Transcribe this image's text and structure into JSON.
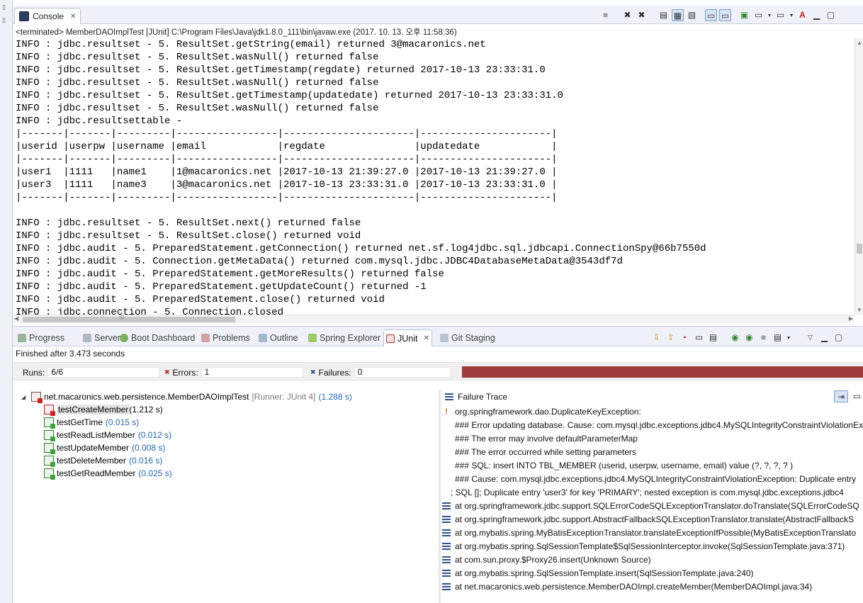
{
  "console": {
    "tab_label": "Console",
    "terminated_line": "<terminated> MemberDAOImplTest [JUnit] C:\\Program Files\\Java\\jdk1.8.0_111\\bin\\javaw.exe (2017. 10. 13. 오후 11:58:36)",
    "lines": [
      "INFO : jdbc.resultset - 5. ResultSet.getString(email) returned 3@macaronics.net",
      "INFO : jdbc.resultset - 5. ResultSet.wasNull() returned false",
      "INFO : jdbc.resultset - 5. ResultSet.getTimestamp(regdate) returned 2017-10-13 23:33:31.0",
      "INFO : jdbc.resultset - 5. ResultSet.wasNull() returned false",
      "INFO : jdbc.resultset - 5. ResultSet.getTimestamp(updatedate) returned 2017-10-13 23:33:31.0",
      "INFO : jdbc.resultset - 5. ResultSet.wasNull() returned false",
      "INFO : jdbc.resultsettable -",
      "|-------|-------|---------|-----------------|----------------------|----------------------|",
      "|userid |userpw |username |email            |regdate               |updatedate            |",
      "|-------|-------|---------|-----------------|----------------------|----------------------|",
      "|user1  |1111   |name1    |1@macaronics.net |2017-10-13 21:39:27.0 |2017-10-13 21:39:27.0 |",
      "|user3  |1111   |name3    |3@macaronics.net |2017-10-13 23:33:31.0 |2017-10-13 23:33:31.0 |",
      "|-------|-------|---------|-----------------|----------------------|----------------------|",
      "",
      "INFO : jdbc.resultset - 5. ResultSet.next() returned false",
      "INFO : jdbc.resultset - 5. ResultSet.close() returned void",
      "INFO : jdbc.audit - 5. PreparedStatement.getConnection() returned net.sf.log4jdbc.sql.jdbcapi.ConnectionSpy@66b7550d",
      "INFO : jdbc.audit - 5. Connection.getMetaData() returned com.mysql.jdbc.JDBC4DatabaseMetaData@3543df7d",
      "INFO : jdbc.audit - 5. PreparedStatement.getMoreResults() returned false",
      "INFO : jdbc.audit - 5. PreparedStatement.getUpdateCount() returned -1",
      "INFO : jdbc.audit - 5. PreparedStatement.close() returned void",
      "INFO : jdbc.connection - 5. Connection.closed"
    ]
  },
  "bottom_tabs": [
    {
      "label": "Progress",
      "icon": "progress-icon"
    },
    {
      "label": "Servers",
      "icon": "servers-icon"
    },
    {
      "label": "Boot Dashboard",
      "icon": "boot-dashboard-icon"
    },
    {
      "label": "Problems",
      "icon": "problems-icon"
    },
    {
      "label": "Outline",
      "icon": "outline-icon"
    },
    {
      "label": "Spring Explorer",
      "icon": "spring-explorer-icon"
    },
    {
      "label": "JUnit",
      "icon": "junit-icon"
    },
    {
      "label": "Git Staging",
      "icon": "git-staging-icon"
    }
  ],
  "junit": {
    "finished": "Finished after 3.473 seconds",
    "runs_label": "Runs:",
    "runs_value": "6/6",
    "errors_label": "Errors:",
    "errors_value": "1",
    "failures_label": "Failures:",
    "failures_value": "0",
    "progress_fraction": 1.0,
    "status_color": "#9f3a3a",
    "suite": {
      "name": "net.macaronics.web.persistence.MemberDAOImplTest",
      "runner": "[Runner: JUnit 4]",
      "time": "(1.288 s)"
    },
    "tests": [
      {
        "name": "testCreateMember",
        "time": "(1.212 s)",
        "status": "error"
      },
      {
        "name": "testGetTime",
        "time": "(0.015 s)",
        "status": "ok"
      },
      {
        "name": "testReadListMember",
        "time": "(0.012 s)",
        "status": "ok"
      },
      {
        "name": "testUpdateMember",
        "time": "(0.008 s)",
        "status": "ok"
      },
      {
        "name": "testDeleteMember",
        "time": "(0.016 s)",
        "status": "ok"
      },
      {
        "name": "testGetReadMember",
        "time": "(0.025 s)",
        "status": "ok"
      }
    ]
  },
  "failure_trace": {
    "title": "Failure Trace",
    "exception": "org.springframework.dao.DuplicateKeyException:",
    "messages": [
      "### Error updating database.  Cause: com.mysql.jdbc.exceptions.jdbc4.MySQLIntegrityConstraintViolationException",
      "### The error may involve defaultParameterMap",
      "### The error occurred while setting parameters",
      "### SQL: insert INTO TBL_MEMBER (userid, userpw, username, email)        value (?, ?, ?, ? )",
      "### Cause: com.mysql.jdbc.exceptions.jdbc4.MySQLIntegrityConstraintViolationException: Duplicate entry",
      "; SQL []; Duplicate entry 'user3' for key 'PRIMARY'; nested exception is com.mysql.jdbc.exceptions.jdbc4"
    ],
    "frames": [
      "at org.springframework.jdbc.support.SQLErrorCodeSQLExceptionTranslator.doTranslate(SQLErrorCodeSQ",
      "at org.springframework.jdbc.support.AbstractFallbackSQLExceptionTranslator.translate(AbstractFallbackS",
      "at org.mybatis.spring.MyBatisExceptionTranslator.translateExceptionIfPossible(MyBatisExceptionTranslato",
      "at org.mybatis.spring.SqlSessionTemplate$SqlSessionInterceptor.invoke(SqlSessionTemplate.java:371)",
      "at com.sun.proxy.$Proxy26.insert(Unknown Source)",
      "at org.mybatis.spring.SqlSessionTemplate.insert(SqlSessionTemplate.java:240)",
      "at net.macaronics.web.persistence.MemberDAOImpl.createMember(MemberDAOImpl.java:34)"
    ]
  }
}
